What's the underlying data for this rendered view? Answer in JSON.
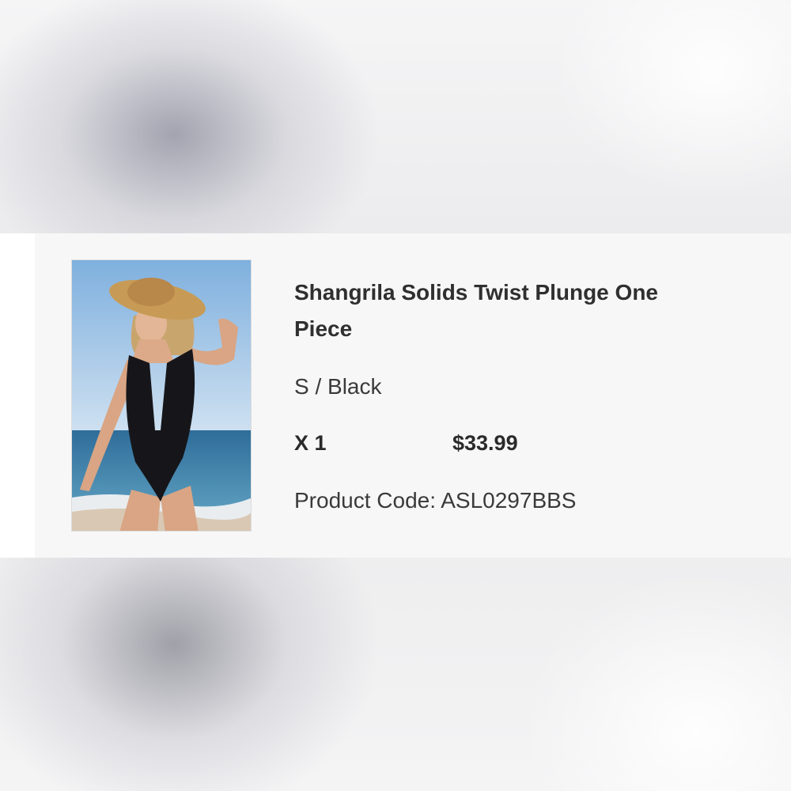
{
  "product": {
    "title": "Shangrila Solids Twist Plunge One Piece",
    "variant": "S / Black",
    "quantity": "X 1",
    "price": "$33.99",
    "product_code": "Product Code: ASL0297BBS",
    "image_icon": "product-photo-swimsuit"
  },
  "colors": {
    "card_background": "#f7f7f7",
    "text_primary": "#2f2f2f",
    "page_background": "#f1f1f2"
  }
}
